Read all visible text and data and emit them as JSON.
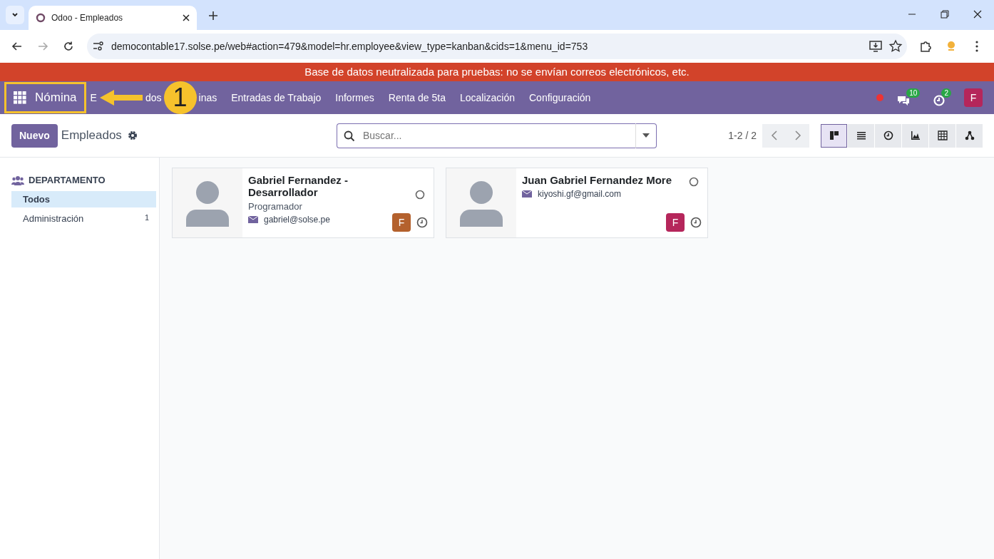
{
  "browser": {
    "tabs": [
      {
        "title": "Odoo - Empleados",
        "selected": true
      }
    ],
    "url": "democontable17.solse.pe/web#action=479&model=hr.employee&view_type=kanban&cids=1&menu_id=753"
  },
  "banner": "Base de datos neutralizada para pruebas: no se envían correos electrónicos, etc.",
  "navbar": {
    "app": "Nómina",
    "covered_fragments": [
      "E",
      "dos",
      "inas"
    ],
    "menu": [
      "Entradas de Trabajo",
      "Informes",
      "Renta de 5ta",
      "Localización",
      "Configuración"
    ],
    "messages_count": "10",
    "activities_count": "2",
    "user_initial": "F"
  },
  "annotation": {
    "step": "1"
  },
  "control_panel": {
    "new_button": "Nuevo",
    "title": "Empleados",
    "search": {
      "placeholder": "Buscar..."
    },
    "pager": "1-2 / 2",
    "views": [
      {
        "kind": "kanban",
        "selected": true
      },
      {
        "kind": "list",
        "selected": false
      },
      {
        "kind": "activity",
        "selected": false
      },
      {
        "kind": "graph",
        "selected": false
      },
      {
        "kind": "pivot",
        "selected": false
      },
      {
        "kind": "hierarchy",
        "selected": false
      }
    ]
  },
  "sidebar": {
    "header": "DEPARTAMENTO",
    "items": [
      {
        "label": "Todos",
        "selected": true
      },
      {
        "label": "Administración",
        "count": "1",
        "selected": false
      }
    ]
  },
  "cards": [
    {
      "name": "Gabriel Fernandez - Desarrollador",
      "job": "Programador",
      "email": "gabriel@solse.pe",
      "initial": "F",
      "color": "#b4612d"
    },
    {
      "name": "Juan Gabriel Fernandez More",
      "email": "kiyoshi.gf@gmail.com",
      "initial": "F",
      "color": "#b5265b"
    }
  ]
}
